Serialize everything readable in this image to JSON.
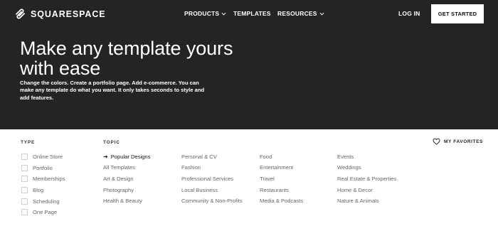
{
  "brand": {
    "name": "SQUARESPACE"
  },
  "nav": {
    "products": "PRODUCTS",
    "templates": "TEMPLATES",
    "resources": "RESOURCES",
    "login": "LOG IN",
    "get_started": "GET STARTED"
  },
  "hero": {
    "title": "Make any template yours with ease",
    "subtitle": "Change the colors. Create a portfolio page. Add e-commerce. You can make any template do what you want. It only takes seconds to style and add features."
  },
  "filters": {
    "type_heading": "TYPE",
    "topic_heading": "TOPIC",
    "favorites_label": "MY FAVORITES",
    "types": [
      "Online Store",
      "Portfolio",
      "Memberships",
      "Blog",
      "Scheduling",
      "One Page"
    ],
    "topics": [
      [
        "Popular Designs",
        "All Templates",
        "Art & Design",
        "Photography",
        "Health & Beauty"
      ],
      [
        "Personal & CV",
        "Fashion",
        "Professional Services",
        "Local Business",
        "Community & Non-Profits"
      ],
      [
        "Food",
        "Entertainment",
        "Travel",
        "Restaurants",
        "Media & Podcasts"
      ],
      [
        "Events",
        "Weddings",
        "Real Estate & Properties",
        "Home & Decor",
        "Nature & Animals"
      ]
    ],
    "active_topic": "Popular Designs"
  },
  "icons": {
    "logo": "squarespace-logo-icon",
    "dropdown": "chevron-down-icon",
    "active_marker": "arrow-right-icon",
    "favorites": "heart-icon"
  },
  "colors": {
    "hero_bg": "#242424",
    "cta_bg": "#ffffff",
    "muted_text": "#666666"
  }
}
